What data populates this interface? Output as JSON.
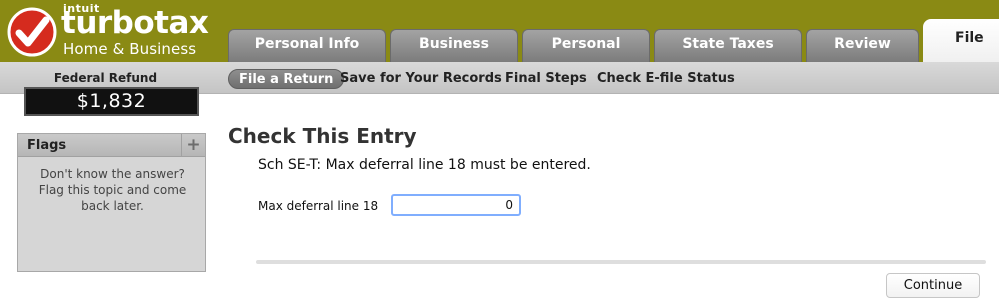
{
  "brand": {
    "company": "intuit",
    "product": "turbotax",
    "edition": "Home & Business",
    "check_color": "#d52b1e"
  },
  "tabs": [
    {
      "label": "Personal Info",
      "active": false
    },
    {
      "label": "Business",
      "active": false
    },
    {
      "label": "Personal",
      "active": false
    },
    {
      "label": "State Taxes",
      "active": false
    },
    {
      "label": "Review",
      "active": false
    },
    {
      "label": "File",
      "active": true
    }
  ],
  "subnav": [
    {
      "label": "File a Return",
      "active": true
    },
    {
      "label": "Save for Your Records",
      "active": false
    },
    {
      "label": "Final Steps",
      "active": false
    },
    {
      "label": "Check E-file Status",
      "active": false
    }
  ],
  "refund": {
    "label": "Federal Refund",
    "amount": "$1,832"
  },
  "flags": {
    "title": "Flags",
    "add_icon": "plus-icon",
    "text": "Don't know the answer? Flag this topic and come back later."
  },
  "main": {
    "title": "Check This Entry",
    "message": "Sch SE-T: Max deferral line 18 must be entered.",
    "field_label": "Max deferral line 18",
    "field_value": "0"
  },
  "actions": {
    "continue_label": "Continue"
  },
  "colors": {
    "header_bg": "#8a8a14",
    "input_focus": "#80aefe"
  }
}
